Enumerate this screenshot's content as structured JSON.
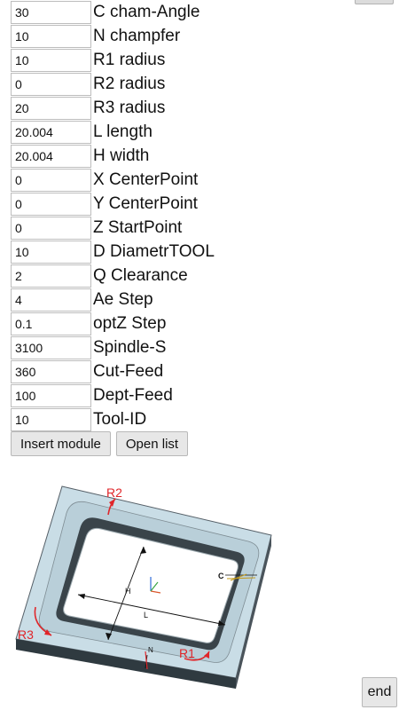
{
  "params": [
    {
      "value": "30",
      "label": "C cham-Angle"
    },
    {
      "value": "10",
      "label": "N champfer"
    },
    {
      "value": "10",
      "label": "R1 radius"
    },
    {
      "value": "0",
      "label": "R2 radius"
    },
    {
      "value": "20",
      "label": "R3 radius"
    },
    {
      "value": "20.004",
      "label": "L length"
    },
    {
      "value": "20.004",
      "label": "H width"
    },
    {
      "value": "0",
      "label": "X CenterPoint"
    },
    {
      "value": "0",
      "label": "Y CenterPoint"
    },
    {
      "value": "0",
      "label": "Z StartPoint"
    },
    {
      "value": "10",
      "label": "D DiametrTOOL"
    },
    {
      "value": "2",
      "label": "Q Clearance"
    },
    {
      "value": "4",
      "label": "Ae Step"
    },
    {
      "value": "0.1",
      "label": "optZ Step"
    },
    {
      "value": "3100",
      "label": "Spindle-S"
    },
    {
      "value": "360",
      "label": "Cut-Feed"
    },
    {
      "value": "100",
      "label": "Dept-Feed"
    },
    {
      "value": "10",
      "label": "Tool-ID"
    }
  ],
  "buttons": {
    "insert_module": "Insert module",
    "open_list": "Open list",
    "end": "end"
  },
  "diagram": {
    "labels": {
      "r2": "R2",
      "r3": "R3",
      "r1": "R1",
      "c": "C",
      "h": "H",
      "l": "L",
      "n": "N"
    },
    "colors": {
      "red": "#e0262a",
      "frame_top": "#c9dde6",
      "frame_side": "#4a545b",
      "frame_front": "#2f3a40",
      "pocket_wall": "#9aa7ad",
      "pocket_floor": "#ffffff"
    }
  }
}
